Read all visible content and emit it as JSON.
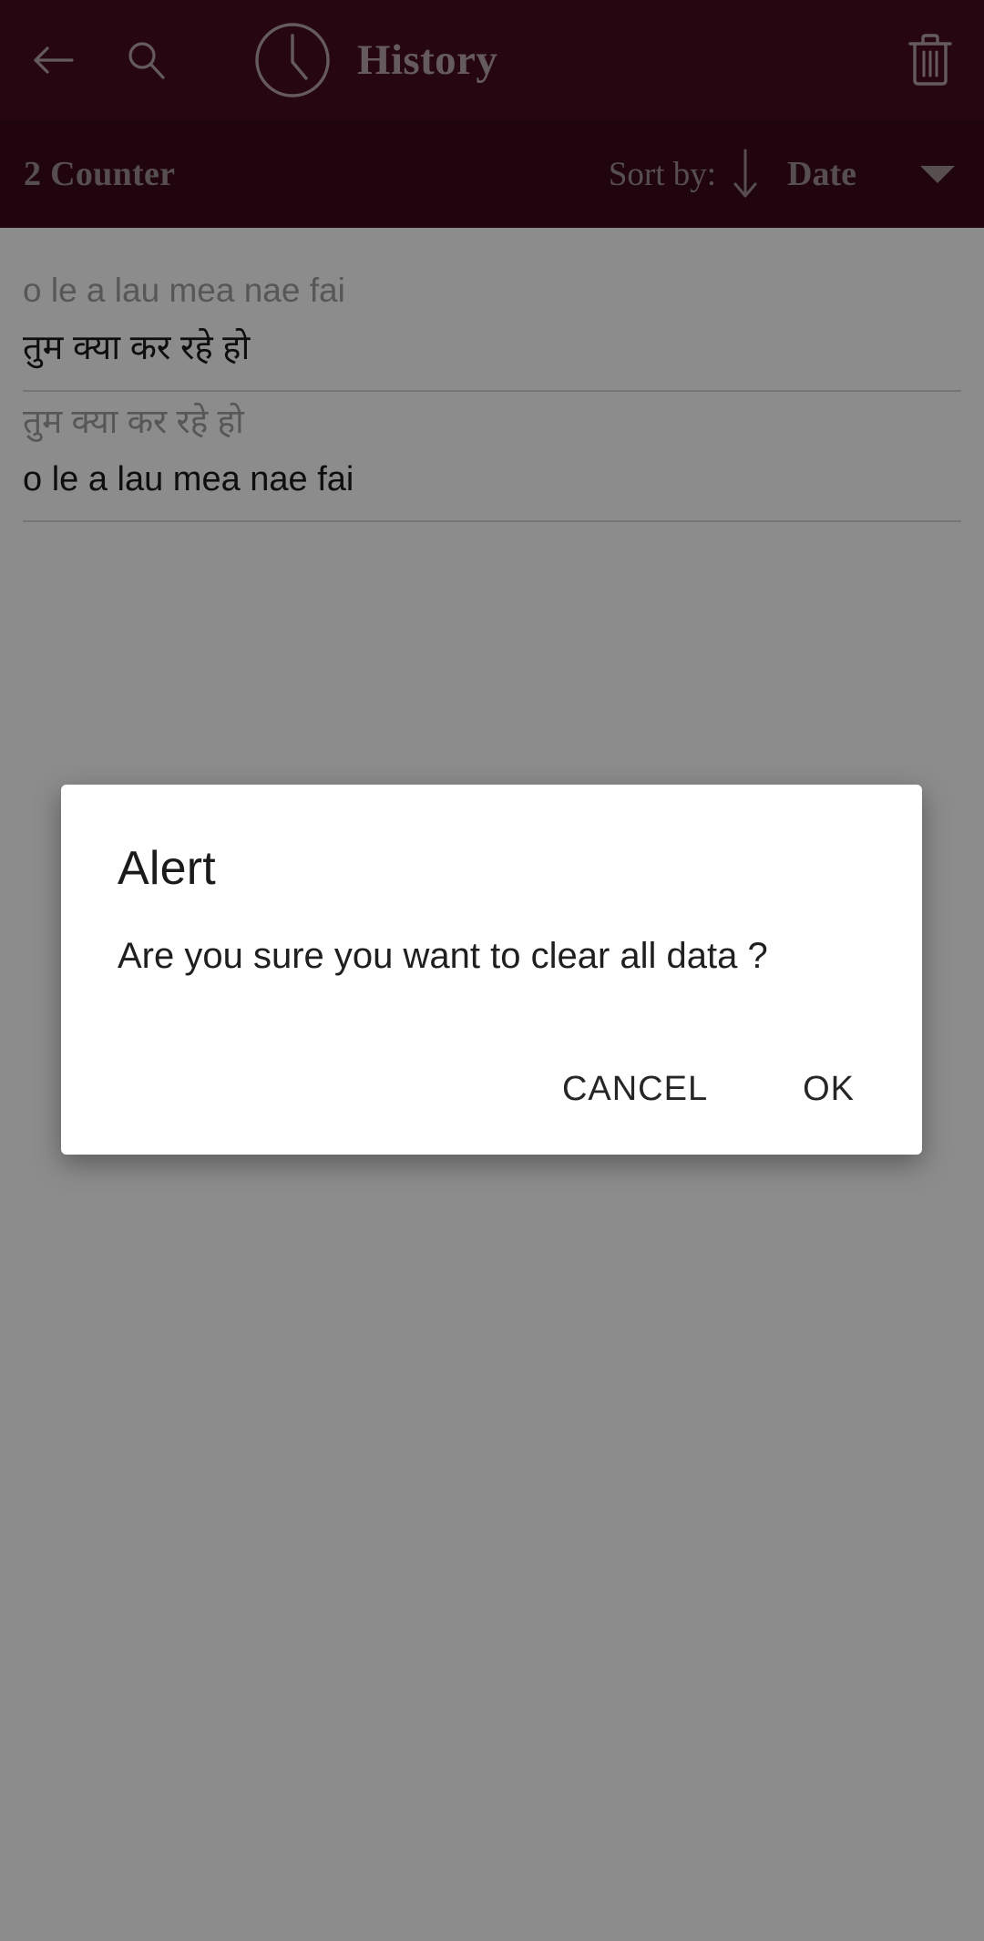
{
  "theme": {
    "appbar_bg": "#460d1f",
    "sortbar_bg": "#3c0a1a",
    "appbar_fg": "#b9a7ac",
    "sortbar_fg": "#9f8e93",
    "scrim": "rgba(0,0,0,0.45)",
    "dialog_bg": "#ffffff"
  },
  "appbar": {
    "back_icon": "arrow-left-icon",
    "search_icon": "search-icon",
    "clock_icon": "clock-icon",
    "title": "History",
    "delete_icon": "trash-icon"
  },
  "sortbar": {
    "counter": "2 Counter",
    "sort_by_label": "Sort by:",
    "direction_icon": "arrow-down-icon",
    "sort_field": "Date",
    "dropdown_icon": "caret-down-icon"
  },
  "history": {
    "items": [
      {
        "source": "o le a lau mea nae fai",
        "result": "तुम क्या कर रहे हो"
      },
      {
        "source": "तुम क्या कर रहे हो",
        "result": "o le a lau mea nae fai"
      }
    ]
  },
  "dialog": {
    "title": "Alert",
    "message": "Are you sure you want to clear all data ?",
    "cancel_label": "CANCEL",
    "ok_label": "OK"
  }
}
